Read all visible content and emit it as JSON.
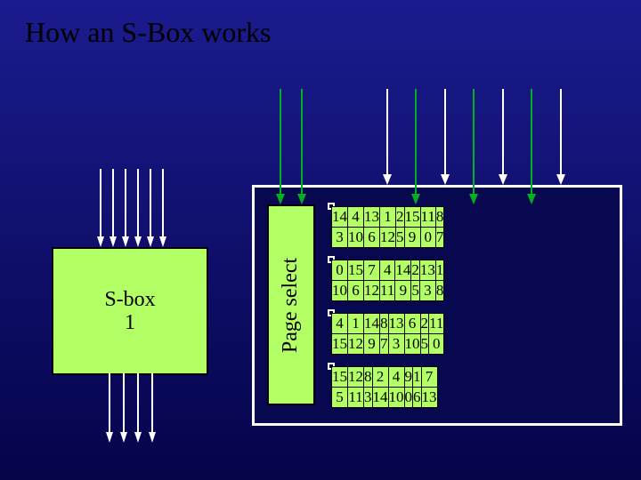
{
  "title": "How an S-Box works",
  "left_box": {
    "line1": "S-box",
    "line2": "1"
  },
  "page_select_label": "Page select",
  "tables": [
    [
      [
        14,
        4,
        13,
        1,
        2,
        15,
        11,
        8
      ],
      [
        3,
        10,
        6,
        12,
        5,
        9,
        0,
        7
      ]
    ],
    [
      [
        0,
        15,
        7,
        4,
        14,
        2,
        13,
        1
      ],
      [
        10,
        6,
        12,
        11,
        9,
        5,
        3,
        8
      ]
    ],
    [
      [
        4,
        1,
        14,
        8,
        13,
        6,
        2,
        11
      ],
      [
        15,
        12,
        9,
        7,
        3,
        10,
        5,
        0
      ]
    ],
    [
      [
        15,
        12,
        8,
        2,
        4,
        9,
        1,
        7
      ],
      [
        5,
        11,
        3,
        14,
        10,
        0,
        6,
        13
      ]
    ]
  ]
}
